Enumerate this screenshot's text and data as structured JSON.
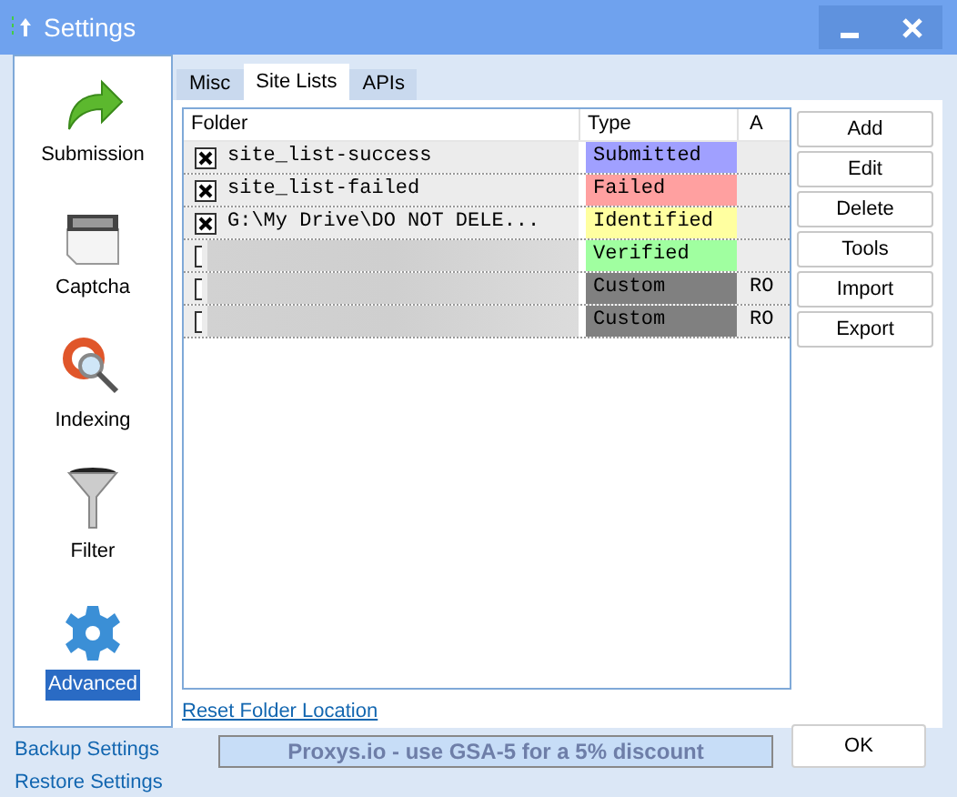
{
  "window": {
    "title": "Settings"
  },
  "sidebar": {
    "items": [
      {
        "label": "Submission",
        "kind": "arrow",
        "selected": false
      },
      {
        "label": "Captcha",
        "kind": "captcha",
        "selected": false
      },
      {
        "label": "Indexing",
        "kind": "indexing",
        "selected": false
      },
      {
        "label": "Filter",
        "kind": "filter",
        "selected": false
      },
      {
        "label": "Advanced",
        "kind": "gear",
        "selected": true
      }
    ]
  },
  "tabs": [
    {
      "label": "Misc",
      "selected": false
    },
    {
      "label": "Site Lists",
      "selected": true
    },
    {
      "label": "APIs",
      "selected": false
    }
  ],
  "table": {
    "columns": [
      "Folder",
      "Type",
      "A"
    ],
    "rows": [
      {
        "checked": true,
        "folder": "site_list-success",
        "type": "Submitted",
        "color": "#a0a0ff"
      },
      {
        "checked": true,
        "folder": "site_list-failed",
        "type": "Failed",
        "color": "#ffa0a0"
      },
      {
        "checked": true,
        "folder": "G:\\My Drive\\DO NOT DELE...",
        "type": "Identified",
        "color": "#ffffa0"
      },
      {
        "checked": false,
        "type": "Verified",
        "color": "#a0ffa0"
      },
      {
        "checked": false,
        "type": "Custom",
        "color": "#808080",
        "column_3": "RO"
      },
      {
        "checked": false,
        "type": "Custom",
        "color": "#808080",
        "column_3": "RO"
      }
    ]
  },
  "buttons": [
    "Add",
    "Edit",
    "Delete",
    "Tools",
    "Import",
    "Export"
  ],
  "reset_link": "Reset Folder Location",
  "footer": {
    "links": [
      "Backup Settings",
      "Restore Settings"
    ],
    "banner": "Proxys.io - use GSA-5 for a 5% discount",
    "ok_button": "OK"
  }
}
